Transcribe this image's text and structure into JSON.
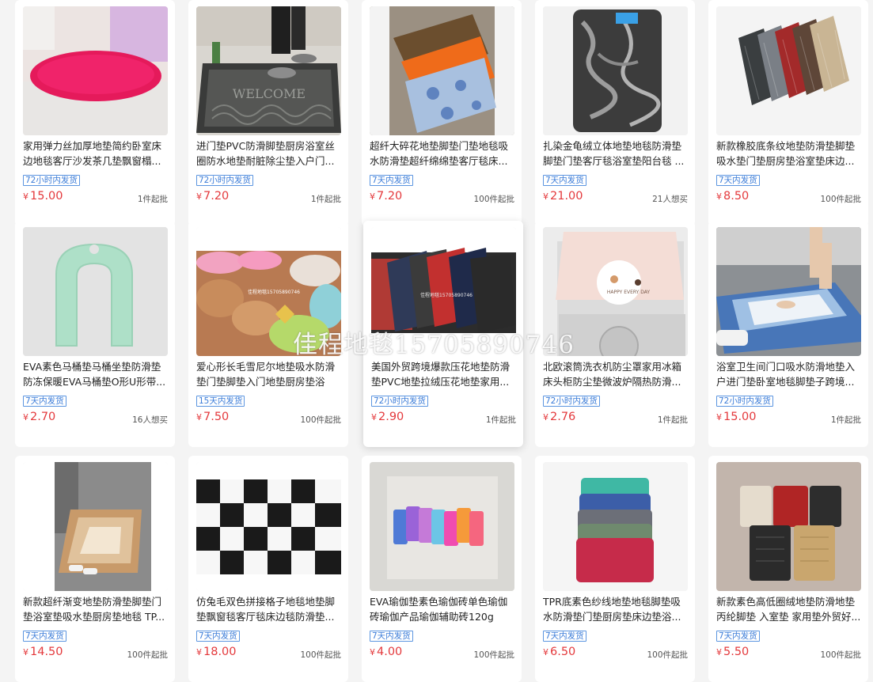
{
  "products": [
    {
      "title": "家用弹力丝加厚地垫简约卧室床边地毯客厅沙发茶几垫飘窗榻...",
      "tag": "72小时内发货",
      "currency": "¥",
      "price": "15.00",
      "moq": "1件起批"
    },
    {
      "title": "进门垫PVC防滑脚垫厨房浴室丝圈防水地垫耐脏除尘垫入户门...",
      "tag": "72小时内发货",
      "currency": "¥",
      "price": "7.20",
      "moq": "1件起批"
    },
    {
      "title": "超纤大碎花地垫脚垫门垫地毯吸水防滑垫超纤绵绵垫客厅毯床...",
      "tag": "7天内发货",
      "currency": "¥",
      "price": "7.20",
      "moq": "100件起批"
    },
    {
      "title": "扎染金龟绒立体地垫地毯防滑垫脚垫门垫客厅毯浴室垫阳台毯 ...",
      "tag": "7天内发货",
      "currency": "¥",
      "price": "21.00",
      "moq": "21人想买"
    },
    {
      "title": "新款橡胶底条纹地垫防滑垫脚垫吸水垫门垫厨房垫浴室垫床边...",
      "tag": "7天内发货",
      "currency": "¥",
      "price": "8.50",
      "moq": "100件起批"
    },
    {
      "title": "EVA素色马桶垫马桶坐垫防滑垫防冻保暖EVA马桶垫O形U形带...",
      "tag": "7天内发货",
      "currency": "¥",
      "price": "2.70",
      "moq": "16人想买"
    },
    {
      "title": "爱心形长毛雪尼尔地垫吸水防滑垫门垫脚垫入门地垫厨房垫浴室...",
      "tag": "15天内发货",
      "currency": "¥",
      "price": "7.50",
      "moq": "100件起批"
    },
    {
      "title": "美国外贸跨境爆款压花地垫防滑垫PVC地垫拉绒压花地垫家用...",
      "tag": "72小时内发货",
      "currency": "¥",
      "price": "2.90",
      "moq": "1件起批"
    },
    {
      "title": "北欧滚筒洗衣机防尘罩家用冰箱床头柜防尘垫微波炉隔热防滑...",
      "tag": "72小时内发货",
      "currency": "¥",
      "price": "2.76",
      "moq": "1件起批"
    },
    {
      "title": "浴室卫生间门口吸水防滑地垫入户进门垫卧室地毯脚垫子跨境...",
      "tag": "72小时内发货",
      "currency": "¥",
      "price": "15.00",
      "moq": "1件起批"
    },
    {
      "title": "新款超纤渐变地垫防滑垫脚垫门垫浴室垫吸水垫厨房垫地毯 TP...",
      "tag": "7天内发货",
      "currency": "¥",
      "price": "14.50",
      "moq": "100件起批"
    },
    {
      "title": "仿兔毛双色拼接格子地毯地垫脚垫飘窗毯客厅毯床边毯防滑垫...",
      "tag": "7天内发货",
      "currency": "¥",
      "price": "18.00",
      "moq": "100件起批"
    },
    {
      "title": "EVA瑜伽垫素色瑜伽砖单色瑜伽砖瑜伽产品瑜伽辅助砖120g 尺...",
      "tag": "7天内发货",
      "currency": "¥",
      "price": "4.00",
      "moq": "100件起批"
    },
    {
      "title": "TPR底素色纱线地垫地毯脚垫吸水防滑垫门垫厨房垫床边垫浴...",
      "tag": "7天内发货",
      "currency": "¥",
      "price": "6.50",
      "moq": "100件起批"
    },
    {
      "title": "新款素色高低圈绒地垫防滑地垫丙纶脚垫 入室垫 家用垫外贸好...",
      "tag": "7天内发货",
      "currency": "¥",
      "price": "5.50",
      "moq": "100件起批"
    }
  ],
  "image_text": {
    "welcome": "WELCOME",
    "happy": "HAPPY EVERY DAY",
    "watermark_small_1": "佳程地毯15705890746",
    "watermark_small_2": "佳程地毯15705890746",
    "watermark_big": "佳程地毯15705890746"
  },
  "colors": {
    "price": "#e4393c",
    "tag": "#3b7cd8",
    "background": "#f4f4f4"
  }
}
